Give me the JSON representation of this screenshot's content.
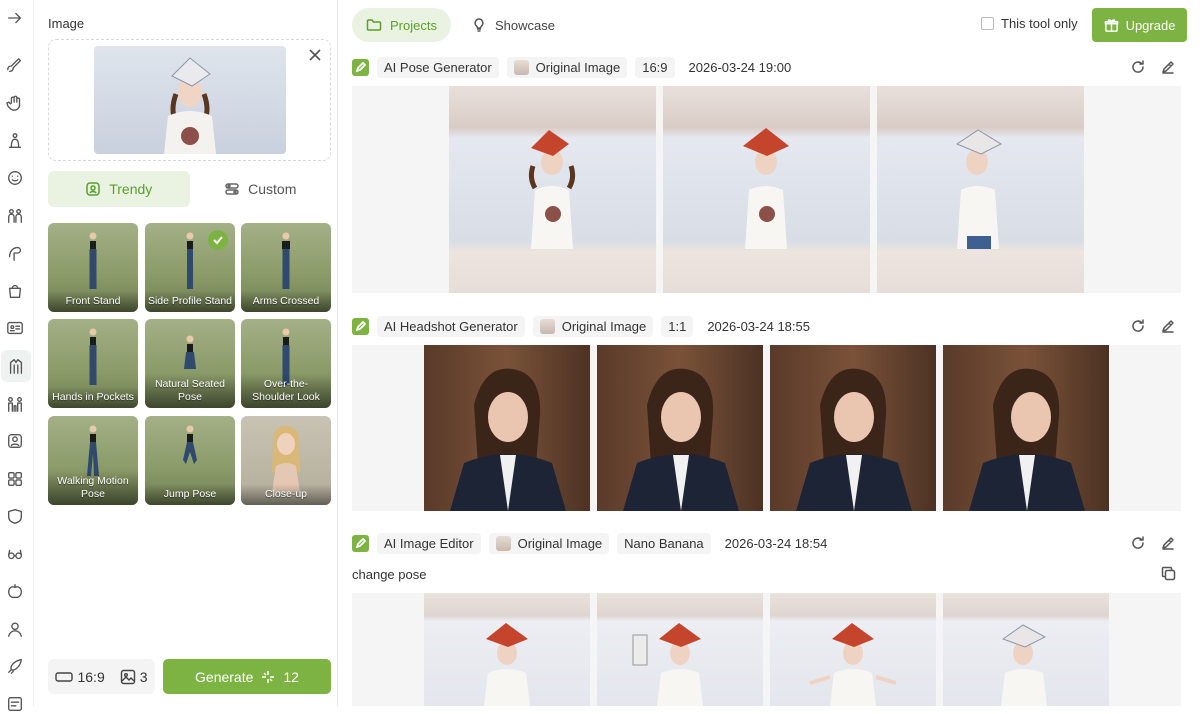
{
  "rail": {
    "icons": [
      "arrow-right-icon",
      "brush-icon",
      "hand-icon",
      "figure-icon",
      "face-swap-icon",
      "group-icon",
      "pose-icon",
      "bag-icon",
      "id-card-icon",
      "outfit-icon",
      "people-icon",
      "portrait-icon",
      "apps-icon",
      "mask-icon",
      "glasses-icon",
      "fruit-icon",
      "user-icon",
      "rocket-icon",
      "doc-icon"
    ],
    "active_index": 9
  },
  "panel": {
    "title": "Image",
    "tabs": {
      "trendy": "Trendy",
      "custom": "Custom",
      "active": "trendy"
    },
    "poses": [
      {
        "label": "Front Stand",
        "selected": false
      },
      {
        "label": "Side Profile Stand",
        "selected": true
      },
      {
        "label": "Arms Crossed",
        "selected": false
      },
      {
        "label": "Hands in Pockets",
        "selected": false
      },
      {
        "label": "Natural Seated Pose",
        "selected": false
      },
      {
        "label": "Over-the-Shoulder Look",
        "selected": false
      },
      {
        "label": "Walking Motion Pose",
        "selected": false
      },
      {
        "label": "Jump Pose",
        "selected": false
      },
      {
        "label": "Close-up",
        "selected": false
      }
    ],
    "ratio": "16:9",
    "count": "3",
    "generate_label": "Generate",
    "credits": "12"
  },
  "topbar": {
    "tabs": {
      "projects": "Projects",
      "showcase": "Showcase"
    },
    "tool_only_label": "This tool only",
    "upgrade_label": "Upgrade"
  },
  "projects": [
    {
      "tool": "AI Pose Generator",
      "source": "Original Image",
      "param": "16:9",
      "time": "2026-03-24 19:00"
    },
    {
      "tool": "AI Headshot Generator",
      "source": "Original Image",
      "param": "1:1",
      "time": "2026-03-24 18:55"
    },
    {
      "tool": "AI Image Editor",
      "source": "Original Image",
      "param": "Nano Banana",
      "time": "2026-03-24 18:54",
      "prompt": "change pose"
    }
  ],
  "colors": {
    "accent": "#7cb342",
    "accent_text": "#5a9e2c",
    "accent_bg": "#eaf3e2"
  }
}
